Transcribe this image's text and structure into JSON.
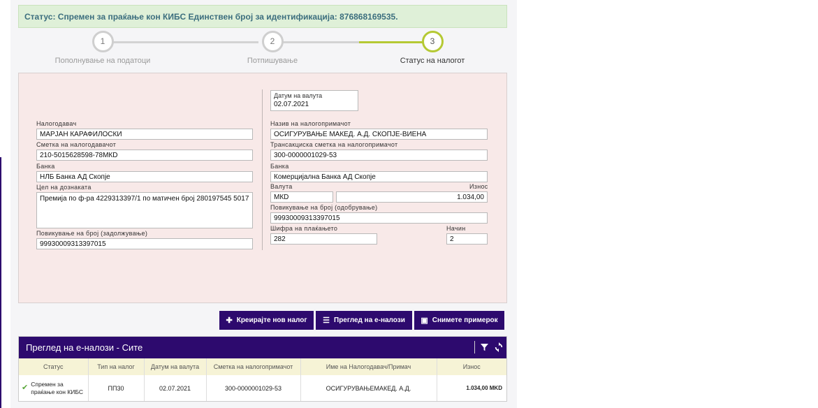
{
  "status_bar": {
    "text": "Статус: Спремен за праќање кон КИБС Единствен број за идентификација: 876868169535."
  },
  "steps": [
    {
      "number": "1",
      "label": "Пополнување на податоци"
    },
    {
      "number": "2",
      "label": "Потпишување"
    },
    {
      "number": "3",
      "label": "Статус на налогот"
    }
  ],
  "form": {
    "value_date_label": "Датум на валута",
    "value_date": "02.07.2021",
    "payer_label": "Налогодавач",
    "payer": "МАРЈАН КАРАФИЛОСКИ",
    "payer_account_label": "Сметка на налогодавачот",
    "payer_account": "210-5015628598-78МКD",
    "payer_bank_label": "Банка",
    "payer_bank": "НЛБ Банка АД Скопје",
    "purpose_label": "Цел на дознаката",
    "purpose": "Премија по ф-ра 4229313397/1 по матичен број 280197545 5017",
    "debit_ref_label": "Повикување на број (задолжување)",
    "debit_ref": "99930009313397015",
    "recipient_label": "Назив на налогопримачот",
    "recipient": "ОСИГУРУВАЊЕ МАКЕД. А.Д. СКОПЈЕ-ВИЕНА",
    "recipient_account_label": "Трансакциска сметка на налогопримачот",
    "recipient_account": "300-0000001029-53",
    "recipient_bank_label": "Банка",
    "recipient_bank": "Комерцијална Банка АД Скопје",
    "currency_label": "Валута",
    "currency": "МКD",
    "amount_label": "Износ",
    "amount": "1.034,00",
    "credit_ref_label": "Повикување на број (одобрување)",
    "credit_ref": "99930009313397015",
    "payment_code_label": "Шифра на плаќањето",
    "payment_code": "282",
    "method_label": "Начин",
    "method": "2"
  },
  "actions": {
    "create_new": "Креирајте нов налог",
    "review": "Преглед на е-налози",
    "save_copy": "Снимете примерок"
  },
  "grid": {
    "title": "Преглед на е-налози - Сите",
    "columns": [
      "Статус",
      "Тип на налог",
      "Датум на валута",
      "Сметка на налогопримачот",
      "Име на Налогодавач/Примач",
      "Износ"
    ],
    "rows": [
      {
        "status": "Спремен за праќање кон КИБС",
        "type": "ПП30",
        "date": "02.07.2021",
        "account": "300-0000001029-53",
        "name": "ОСИГУРУВАЊЕМАКЕД. А.Д.",
        "amount": "1.034,00 MKD"
      }
    ]
  },
  "icons": {
    "status_ok": "check-icon",
    "filter": "filter-icon",
    "refresh": "refresh-icon"
  },
  "colors": {
    "primary": "#2d0a6e",
    "accent": "#b5c934",
    "status_bg": "#dff0d8",
    "panel_bg": "#f8e9e8"
  }
}
